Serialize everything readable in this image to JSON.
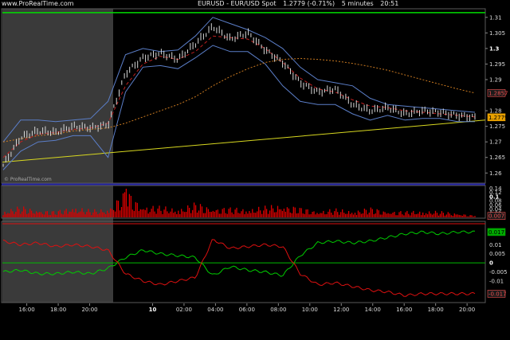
{
  "header": {
    "brand": "www.ProRealTime.com",
    "instrument": "EURUSD - EUR/USD Spot",
    "quote": "1.2779 (-0.71%)",
    "interval": "5 minutes",
    "time": "20:51",
    "watermark": "© ProRealTime.com"
  },
  "colors": {
    "background": "#000000",
    "highlight_band": "#3a3a3a",
    "candles": "#d8d8d8",
    "bollinger": "#5b7ec8",
    "ma_short": "#c02020",
    "ma_long": "#c87820",
    "resistance": "#00dd00",
    "support": "#d8d820",
    "volume": "#dd0000",
    "di_plus": "#00cc00",
    "di_minus": "#dd1010"
  },
  "chart_data": [
    {
      "type": "line",
      "panel": "price",
      "title": "EURUSD - EUR/USD Spot",
      "x_ticks": [
        "16:00",
        "18:00",
        "20:00",
        "10",
        "02:00",
        "04:00",
        "06:00",
        "08:00",
        "10:00",
        "12:00",
        "14:00",
        "16:00",
        "18:00",
        "20:00"
      ],
      "y_ticks": [
        "1.31",
        "1.305",
        "1.3",
        "1.295",
        "1.29",
        "1.2857",
        "1.28",
        "1.2779",
        "1.275",
        "1.27",
        "1.265",
        "1.26"
      ],
      "y_tick_values": [
        1.31,
        1.305,
        1.3,
        1.295,
        1.29,
        1.2857,
        1.28,
        1.2779,
        1.275,
        1.27,
        1.265,
        1.26
      ],
      "ylim": [
        1.257,
        1.3125
      ],
      "x": [
        0,
        1,
        2,
        3,
        4,
        5,
        6,
        7,
        8,
        9,
        10,
        11,
        12,
        13,
        14,
        15,
        16,
        17,
        18,
        19,
        20,
        21,
        22,
        23,
        24,
        25,
        26,
        27
      ],
      "x_hours": [
        14.5,
        15.5,
        16.5,
        17.5,
        18.5,
        19.5,
        20.5,
        21.5,
        22.5,
        23.5,
        24.5,
        25.5,
        26.5,
        27.5,
        28.5,
        29.5,
        30.5,
        31.5,
        32.5,
        33.5,
        34.5,
        35.5,
        36.5,
        37.5,
        38.5,
        39.5,
        40.5,
        41.5
      ],
      "series": [
        {
          "name": "EURUSD",
          "values": [
            1.2625,
            1.2715,
            1.2735,
            1.273,
            1.275,
            1.2745,
            1.2755,
            1.292,
            1.297,
            1.2985,
            1.2965,
            1.3015,
            1.307,
            1.303,
            1.305,
            1.2995,
            1.2955,
            1.289,
            1.286,
            1.287,
            1.282,
            1.28,
            1.281,
            1.279,
            1.28,
            1.2795,
            1.2785,
            1.2779
          ]
        },
        {
          "name": "Bollinger upper",
          "values": [
            1.27,
            1.277,
            1.277,
            1.2765,
            1.277,
            1.2775,
            1.283,
            1.298,
            1.3,
            1.299,
            1.2995,
            1.304,
            1.31,
            1.308,
            1.306,
            1.3035,
            1.3,
            1.294,
            1.29,
            1.289,
            1.288,
            1.284,
            1.282,
            1.2815,
            1.281,
            1.2805,
            1.28,
            1.2795
          ]
        },
        {
          "name": "Bollinger lower",
          "values": [
            1.261,
            1.267,
            1.27,
            1.2705,
            1.272,
            1.272,
            1.265,
            1.286,
            1.294,
            1.2945,
            1.2935,
            1.297,
            1.301,
            1.299,
            1.299,
            1.295,
            1.288,
            1.283,
            1.282,
            1.282,
            1.279,
            1.277,
            1.2785,
            1.277,
            1.2775,
            1.2775,
            1.2765,
            1.2765
          ]
        },
        {
          "name": "MA short",
          "values": [
            1.265,
            1.27,
            1.2725,
            1.273,
            1.274,
            1.2745,
            1.276,
            1.288,
            1.295,
            1.2975,
            1.2965,
            1.299,
            1.304,
            1.3035,
            1.303,
            1.3,
            1.2955,
            1.2905,
            1.287,
            1.286,
            1.2835,
            1.2815,
            1.281,
            1.28,
            1.2795,
            1.279,
            1.2785,
            1.278
          ]
        },
        {
          "name": "MA long",
          "values": [
            1.27,
            1.271,
            1.272,
            1.2725,
            1.2735,
            1.274,
            1.2745,
            1.276,
            1.278,
            1.28,
            1.282,
            1.2845,
            1.288,
            1.291,
            1.2935,
            1.2955,
            1.2965,
            1.2968,
            1.2965,
            1.296,
            1.2952,
            1.2942,
            1.293,
            1.2915,
            1.29,
            1.2885,
            1.287,
            1.2857
          ]
        },
        {
          "name": "Resistance",
          "values": [
            1.3115,
            1.3115
          ]
        },
        {
          "name": "Support",
          "values": [
            1.2635,
            1.277
          ]
        }
      ],
      "support_x": [
        0,
        27
      ],
      "grid": false,
      "legend": "none"
    },
    {
      "type": "bar",
      "panel": "volume",
      "y_ticks": [
        "0.14",
        "0.12",
        "0.1",
        "0.08",
        "0.06",
        "0.04",
        "0.02",
        "0.007"
      ],
      "y_tick_values": [
        0.14,
        0.12,
        0.1,
        0.08,
        0.06,
        0.04,
        0.02,
        0.007
      ],
      "ylim": [
        0,
        0.145
      ],
      "values": [
        0.03,
        0.045,
        0.035,
        0.025,
        0.05,
        0.03,
        0.04,
        0.115,
        0.055,
        0.045,
        0.04,
        0.06,
        0.045,
        0.04,
        0.04,
        0.045,
        0.06,
        0.04,
        0.03,
        0.035,
        0.03,
        0.04,
        0.03,
        0.025,
        0.03,
        0.025,
        0.02,
        0.007
      ]
    },
    {
      "type": "line",
      "panel": "directional",
      "y_ticks": [
        "0.017",
        "0.01",
        "0.005",
        "0",
        "-0.005",
        "-0.01",
        "-0.017"
      ],
      "y_tick_values": [
        0.017,
        0.01,
        0.005,
        0,
        -0.005,
        -0.01,
        -0.017
      ],
      "ylim": [
        -0.021,
        0.022
      ],
      "series": [
        {
          "name": "DI+",
          "values": [
            -0.005,
            -0.004,
            -0.006,
            -0.006,
            -0.005,
            -0.006,
            -0.003,
            0.003,
            0.007,
            0.005,
            0.004,
            0.003,
            -0.007,
            -0.002,
            -0.004,
            -0.005,
            -0.007,
            0.004,
            0.011,
            0.012,
            0.011,
            0.012,
            0.014,
            0.016,
            0.017,
            0.016,
            0.017,
            0.017
          ]
        },
        {
          "name": "DI-",
          "values": [
            0.012,
            0.01,
            0.011,
            0.009,
            0.01,
            0.009,
            0.007,
            -0.006,
            -0.01,
            -0.012,
            -0.01,
            -0.008,
            0.013,
            0.008,
            0.009,
            0.01,
            0.009,
            -0.006,
            -0.012,
            -0.011,
            -0.013,
            -0.015,
            -0.016,
            -0.018,
            -0.017,
            -0.017,
            -0.017,
            -0.017
          ]
        },
        {
          "name": "Zero",
          "values": [
            0,
            0
          ]
        }
      ]
    }
  ]
}
